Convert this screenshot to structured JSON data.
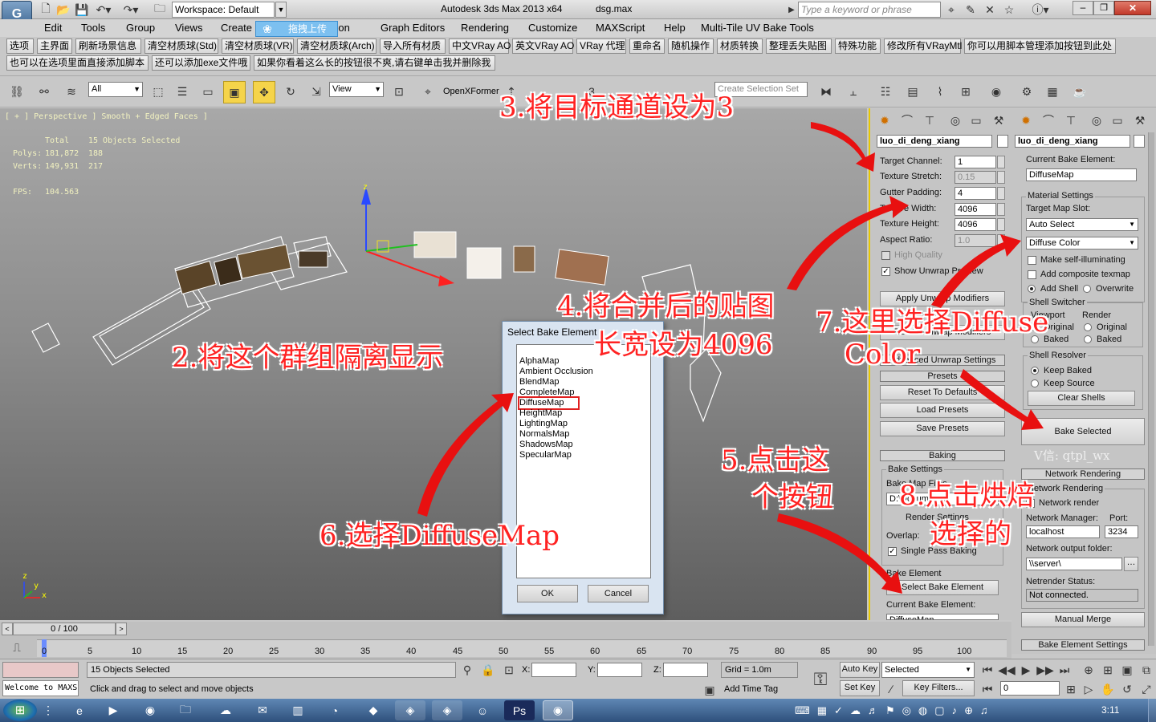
{
  "titlebar": {
    "app_title": "Autodesk 3ds Max  2013 x64",
    "file_name": "dsg.max",
    "workspace_label": "Workspace: Default",
    "search_placeholder": "Type a keyword or phrase",
    "upload_badge": "拖拽上传"
  },
  "menu": [
    "Edit",
    "Tools",
    "Group",
    "Views",
    "Create",
    "Animation",
    "Graph Editors",
    "Rendering",
    "Customize",
    "MAXScript",
    "Help",
    "Multi-Tile UV Bake Tools"
  ],
  "script_buttons_row1": [
    "选项",
    "主界面",
    "刷新场景信息",
    "清空材质球(Std)",
    "清空材质球(VR)",
    "清空材质球(Arch)",
    "导入所有材质",
    "中文VRay AO",
    "英文VRay AO",
    "VRay 代理",
    "重命名",
    "随机操作",
    "材质转换",
    "整理丢失贴图",
    "特殊功能",
    "修改所有VRayMtl",
    "你可以用脚本管理添加按钮到此处"
  ],
  "script_buttons_row2": [
    "也可以在选项里面直接添加脚本",
    "还可以添加exe文件哦",
    "如果你看着这么长的按钮很不爽,请右键单击我并删除我"
  ],
  "toolbar": {
    "selection_filter": "All",
    "ref_coord": "View",
    "openxformer_label": "OpenXFormer",
    "named_selection_placeholder": "Create Selection Set"
  },
  "viewport": {
    "label": "[ + ] Perspective ] Smooth + Edged Faces ]",
    "stats_total_label": "Total",
    "stats_selected_label": "15 Objects Selected",
    "polys_label": "Polys:",
    "polys_total": "181,872",
    "polys_selected": "188",
    "verts_label": "Verts:",
    "verts_total": "149,931",
    "verts_selected": "217",
    "fps_label": "FPS:",
    "fps_value": "104.563",
    "axis_z": "z",
    "axis_x": "x",
    "axis_y": "y"
  },
  "panel_left": {
    "object_name": "luo_di_deng_xiang",
    "target_channel_label": "Target Channel:",
    "target_channel": "1",
    "texture_stretch_label": "Texture Stretch:",
    "texture_stretch": "0.15",
    "gutter_padding_label": "Gutter Padding:",
    "gutter_padding": "4",
    "texture_width_label": "Texture Width:",
    "texture_width": "4096",
    "texture_height_label": "Texture Height:",
    "texture_height": "4096",
    "aspect_ratio_label": "Aspect Ratio:",
    "aspect_ratio": "1.0",
    "high_quality_label": "High Quality",
    "show_unwrap_label": "Show Unwrap Preview",
    "apply_unwrap_label": "Apply Unwrap Modifiers",
    "delete_unwrap_label": "Delete Unwrap Modifiers",
    "advanced_unwrap_label": "Advanced Unwrap Settings",
    "presets_rollout": "Presets",
    "reset_defaults": "Reset To Defaults",
    "load_presets": "Load Presets",
    "save_presets": "Save Presets",
    "baking_rollout": "Baking",
    "bake_settings_label": "Bake Settings",
    "bake_map_files_label": "Bake Map Files",
    "bake_path": "D:\\Documents",
    "render_settings_label": "Render Settings",
    "overlap_label": "Overlap:",
    "single_pass_label": "Single Pass Baking",
    "bake_element_label": "Bake Element",
    "select_bake_element": "Select Bake Element",
    "current_bake_element_label": "Current Bake Element:",
    "current_bake_element": "DiffuseMap"
  },
  "panel_right": {
    "object_name": "luo_di_deng_xiang",
    "current_bake_element_label": "Current Bake Element:",
    "current_bake_element": "DiffuseMap",
    "material_settings_label": "Material Settings",
    "target_map_slot_label": "Target Map Slot:",
    "auto_select": "Auto Select",
    "diffuse_color": "Diffuse Color",
    "make_self_illum_label": "Make self-illuminating",
    "add_composite_label": "Add composite texmap",
    "add_shell_label": "Add Shell",
    "overwrite_label": "Overwrite",
    "shell_switcher_label": "Shell Switcher",
    "viewport_label": "Viewport",
    "render_label": "Render",
    "original_label": "Original",
    "baked_label": "Baked",
    "shell_resolver_label": "Shell Resolver",
    "keep_baked_label": "Keep Baked",
    "keep_source_label": "Keep Source",
    "clear_shells": "Clear Shells",
    "bake_selected": "Bake Selected",
    "network_rendering_rollout": "Network Rendering",
    "network_rendering_group": "Network Rendering",
    "network_render_label": "Network render",
    "network_manager_label": "Network Manager:",
    "port_label": "Port:",
    "manager_value": "localhost",
    "port_value": "3234",
    "network_output_label": "Network output folder:",
    "output_value": "\\\\server\\",
    "netrender_status_label": "Netrender Status:",
    "status_value": "Not connected.",
    "manual_merge": "Manual Merge",
    "bake_element_settings_rollout": "Bake Element Settings",
    "watermark": "V信: qtpl_wx"
  },
  "dialog": {
    "title": "Select Bake Element",
    "items": [
      "AlphaMap",
      "Ambient Occlusion",
      "BlendMap",
      "CompleteMap",
      "DiffuseMap",
      "HeightMap",
      "LightingMap",
      "NormalsMap",
      "ShadowsMap",
      "SpecularMap"
    ],
    "selected_item": "DiffuseMap",
    "ok": "OK",
    "cancel": "Cancel"
  },
  "annotations": {
    "step2": "2.将这个群组隔离显示",
    "step3": "3.将目标通道设为3",
    "step4_line1": "4.将合并后的贴图",
    "step4_line2": "长宽设为4096",
    "step5_line1": "5.点击这",
    "step5_line2": "个按钮",
    "step6": "6.选择DiffuseMap",
    "step7_line1": "7.这里选择Diffuse",
    "step7_line2": "Color",
    "step8_line1": "8.点击烘焙",
    "step8_line2": "选择的"
  },
  "timeline": {
    "frame_counter": "0 / 100",
    "ticks": [
      "0",
      "5",
      "10",
      "15",
      "20",
      "25",
      "30",
      "35",
      "40",
      "45",
      "50",
      "55",
      "60",
      "65",
      "70",
      "75",
      "80",
      "85",
      "90",
      "95",
      "100"
    ]
  },
  "status": {
    "selection_info": "15 Objects Selected",
    "prompt": "Click and drag to select and move objects",
    "maxscript_listener": "Welcome to MAXS",
    "x_label": "X:",
    "y_label": "Y:",
    "z_label": "Z:",
    "grid": "Grid = 1.0m",
    "add_time_tag": "Add Time Tag",
    "auto_key": "Auto Key",
    "set_key": "Set Key",
    "key_mode": "Selected",
    "key_filters": "Key Filters...",
    "current_frame": "0"
  },
  "taskbar": {
    "clock": "3:11"
  }
}
